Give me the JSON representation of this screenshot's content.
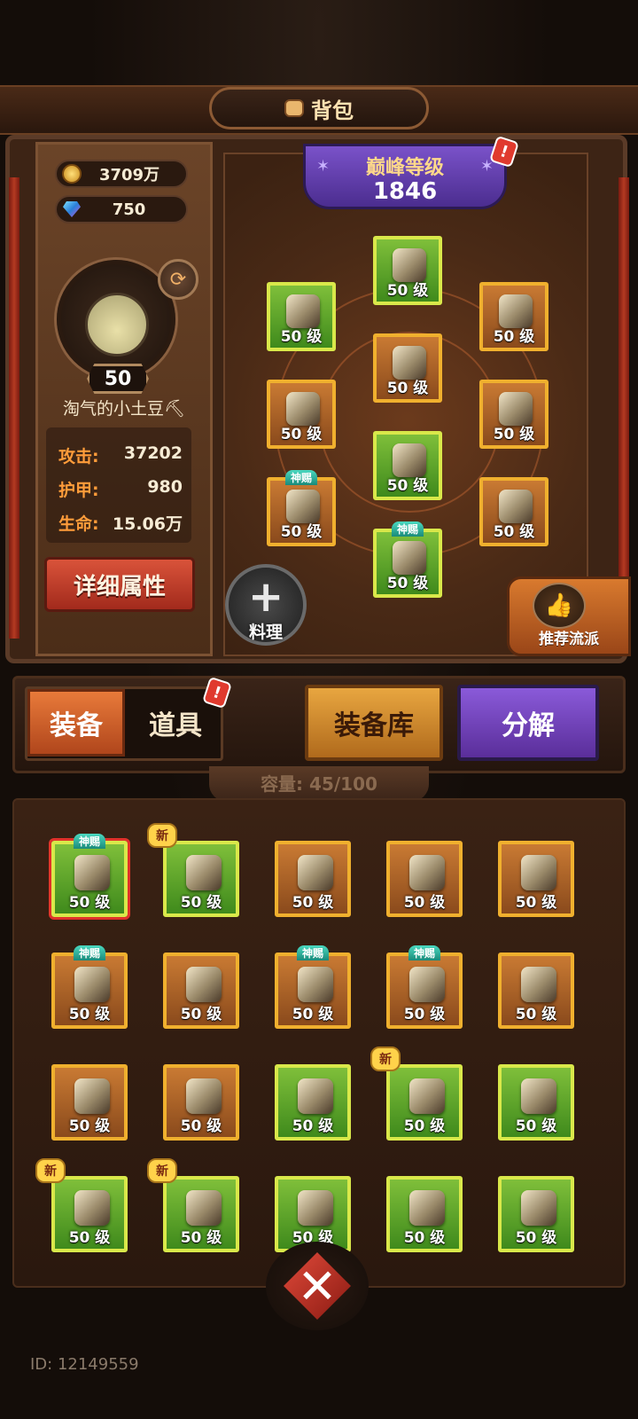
{
  "header": {
    "title": "背包",
    "icon": "bag-icon"
  },
  "currency": {
    "gold": {
      "icon": "gold-coin-icon",
      "value": "3709万"
    },
    "gems": {
      "icon": "gem-icon",
      "value": "750"
    }
  },
  "player": {
    "level": "50",
    "name": "淘气的小土豆⛏",
    "stats": [
      {
        "key": "攻击:",
        "value": "37202"
      },
      {
        "key": "护甲:",
        "value": "980"
      },
      {
        "key": "生命:",
        "value": "15.06万"
      }
    ],
    "detail_button": "详细属性"
  },
  "peak": {
    "label": "巅峰等级",
    "value": "1846",
    "alert": "!"
  },
  "equipped": [
    {
      "slot": "top",
      "level": "50 级",
      "rarity": "green",
      "tag": ""
    },
    {
      "slot": "left-1",
      "level": "50 级",
      "rarity": "green",
      "tag": ""
    },
    {
      "slot": "right-1",
      "level": "50 级",
      "rarity": "orange",
      "tag": ""
    },
    {
      "slot": "center-1",
      "level": "50 级",
      "rarity": "orange",
      "tag": ""
    },
    {
      "slot": "left-2",
      "level": "50 级",
      "rarity": "orange",
      "tag": ""
    },
    {
      "slot": "right-2",
      "level": "50 级",
      "rarity": "orange",
      "tag": ""
    },
    {
      "slot": "center-2",
      "level": "50 级",
      "rarity": "green",
      "tag": ""
    },
    {
      "slot": "left-3",
      "level": "50 级",
      "rarity": "orange",
      "tag": "神赐"
    },
    {
      "slot": "right-3",
      "level": "50 级",
      "rarity": "orange",
      "tag": ""
    },
    {
      "slot": "center-3",
      "level": "50 级",
      "rarity": "green",
      "tag": "神赐"
    }
  ],
  "cook_button": "料理",
  "recommend_button": "推荐流派",
  "tabs": {
    "equipment": "装备",
    "items": "道具",
    "items_alert": "!"
  },
  "buttons": {
    "library": "装备库",
    "decompose": "分解"
  },
  "capacity": "容量: 45/100",
  "inventory": [
    {
      "level": "50 级",
      "rarity": "green",
      "tag": "神赐",
      "new": "",
      "selected": true
    },
    {
      "level": "50 级",
      "rarity": "green",
      "tag": "",
      "new": "新",
      "selected": false
    },
    {
      "level": "50 级",
      "rarity": "orange",
      "tag": "",
      "new": "",
      "selected": false
    },
    {
      "level": "50 级",
      "rarity": "orange",
      "tag": "",
      "new": "",
      "selected": false
    },
    {
      "level": "50 级",
      "rarity": "orange",
      "tag": "",
      "new": "",
      "selected": false
    },
    {
      "level": "50 级",
      "rarity": "orange",
      "tag": "神赐",
      "new": "",
      "selected": false
    },
    {
      "level": "50 级",
      "rarity": "orange",
      "tag": "",
      "new": "",
      "selected": false
    },
    {
      "level": "50 级",
      "rarity": "orange",
      "tag": "神赐",
      "new": "",
      "selected": false
    },
    {
      "level": "50 级",
      "rarity": "orange",
      "tag": "神赐",
      "new": "",
      "selected": false
    },
    {
      "level": "50 级",
      "rarity": "orange",
      "tag": "",
      "new": "",
      "selected": false
    },
    {
      "level": "50 级",
      "rarity": "orange",
      "tag": "",
      "new": "",
      "selected": false
    },
    {
      "level": "50 级",
      "rarity": "orange",
      "tag": "",
      "new": "",
      "selected": false
    },
    {
      "level": "50 级",
      "rarity": "green",
      "tag": "",
      "new": "",
      "selected": false
    },
    {
      "level": "50 级",
      "rarity": "green",
      "tag": "",
      "new": "新",
      "selected": false
    },
    {
      "level": "50 级",
      "rarity": "green",
      "tag": "",
      "new": "",
      "selected": false
    },
    {
      "level": "50 级",
      "rarity": "green",
      "tag": "",
      "new": "新",
      "selected": false
    },
    {
      "level": "50 级",
      "rarity": "green",
      "tag": "",
      "new": "新",
      "selected": false
    },
    {
      "level": "50 级",
      "rarity": "green",
      "tag": "",
      "new": "",
      "selected": false
    },
    {
      "level": "50 级",
      "rarity": "green",
      "tag": "",
      "new": "",
      "selected": false
    },
    {
      "level": "50 级",
      "rarity": "green",
      "tag": "",
      "new": "",
      "selected": false
    }
  ],
  "close_icon": "crossed-swords-close-icon",
  "player_id": "ID: 12149559",
  "colors": {
    "green_frame": "#d9e84a",
    "orange_frame": "#f0b02e",
    "gift_tag": "#4ad9c0",
    "peak": "#7a52c9"
  }
}
